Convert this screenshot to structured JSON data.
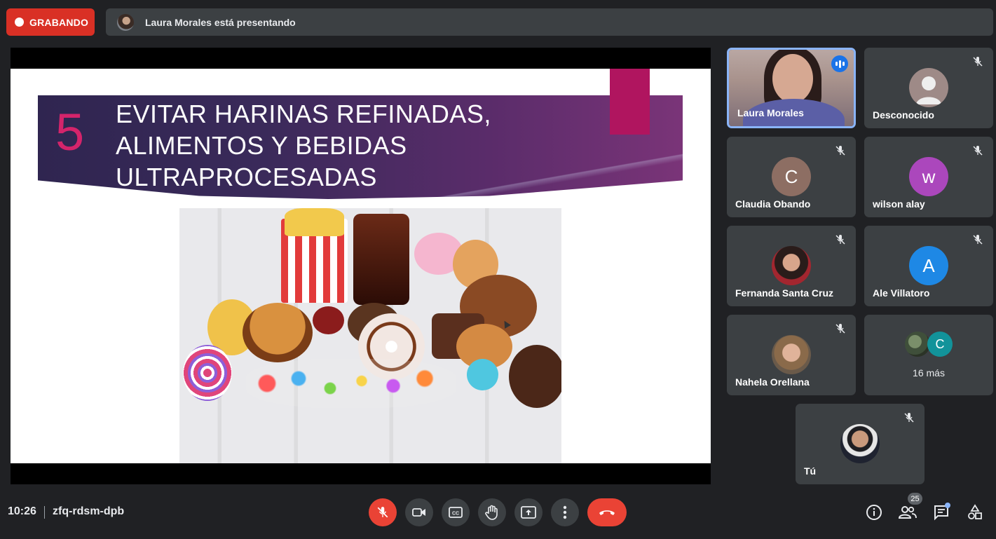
{
  "recording": {
    "label": "GRABANDO"
  },
  "presenter_bar": {
    "text": "Laura Morales está presentando"
  },
  "slide": {
    "number": "5",
    "title_lines": [
      "EVITAR HARINAS REFINADAS,",
      "ALIMENTOS Y BEBIDAS",
      "ULTRAPROCESADAS"
    ]
  },
  "participants": [
    {
      "name": "Laura Morales",
      "type": "video",
      "speaking": true
    },
    {
      "name": "Desconocido",
      "type": "placeholder",
      "muted": true
    },
    {
      "name": "Claudia Obando",
      "type": "initial",
      "initial": "C",
      "color": "#8d6e63",
      "muted": true
    },
    {
      "name": "wilson alay",
      "type": "initial",
      "initial": "w",
      "color": "#ab47bc",
      "muted": true
    },
    {
      "name": "Fernanda Santa Cruz",
      "type": "photo",
      "muted": true
    },
    {
      "name": "Ale Villatoro",
      "type": "initial",
      "initial": "A",
      "color": "#1e88e5",
      "muted": true
    },
    {
      "name": "Nahela Orellana",
      "type": "photo",
      "muted": true
    },
    {
      "name": "Tú",
      "type": "photo",
      "muted": true
    }
  ],
  "more_tile": {
    "label": "16 más",
    "initial": "C"
  },
  "bottom_bar": {
    "time": "10:26",
    "meeting_code": "zfq-rdsm-dpb",
    "participant_count": "25"
  },
  "icons": {
    "mic": "mic-off-icon",
    "camera": "videocam-icon",
    "captions": "closed-caption-icon",
    "hand": "raise-hand-icon",
    "present": "present-screen-icon",
    "more": "more-vert-icon",
    "end_call": "call-end-icon",
    "info": "info-icon",
    "people": "people-icon",
    "chat": "chat-icon",
    "activities": "activities-icon"
  },
  "colors": {
    "record": "#d93025",
    "end_call": "#ea4335",
    "active_border": "#8ab4f8",
    "tile_bg": "#3c4043",
    "slide_accent": "#b0155f"
  }
}
